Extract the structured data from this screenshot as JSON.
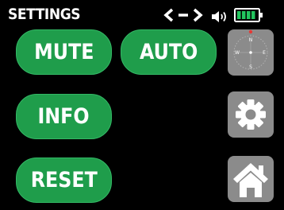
{
  "header": {
    "title": "SETTINGS",
    "link_icon": "link-arrows-icon",
    "speaker_icon": "speaker-icon",
    "battery_icon": "battery-icon",
    "battery_level": 1.0,
    "battery_color": "#22c55e"
  },
  "buttons": {
    "mute_label": "MUTE",
    "auto_label": "AUTO",
    "info_label": "INFO",
    "reset_label": "RESET",
    "color": "#1f9d4b"
  },
  "tiles": {
    "compass": {
      "icon": "compass-icon",
      "n": "N",
      "s": "S",
      "e": "E",
      "w": "W"
    },
    "settings_icon": "gear-icon",
    "home_icon": "home-icon",
    "tile_color": "#8b8b8b"
  },
  "colors": {
    "background": "#000000",
    "text": "#ffffff",
    "accent_red": "#e53935"
  }
}
